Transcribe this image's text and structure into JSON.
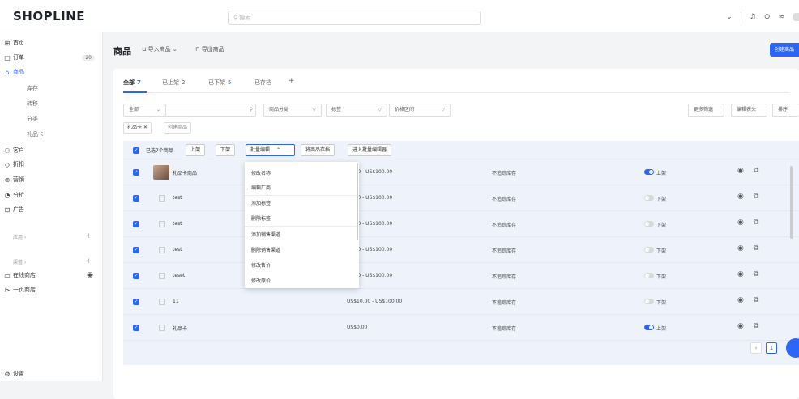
{
  "header": {
    "logo": "SHOPLINE",
    "search_placeholder": "搜索",
    "icons": [
      "chevron-down-icon",
      "bell-icon",
      "help-icon",
      "wifi-icon"
    ]
  },
  "sidebar": {
    "items": [
      {
        "icon": "⊞",
        "label": "首页"
      },
      {
        "icon": "▢",
        "label": "订单",
        "count": "20"
      },
      {
        "icon": "⌂",
        "label": "商品",
        "active": true
      },
      {
        "label": "库存"
      },
      {
        "label": "转移"
      },
      {
        "label": "分类"
      },
      {
        "label": "礼品卡"
      },
      {
        "icon": "⚇",
        "label": "客户"
      },
      {
        "icon": "◇",
        "label": "折扣"
      },
      {
        "icon": "⊚",
        "label": "营销"
      },
      {
        "icon": "◔",
        "label": "分析"
      },
      {
        "icon": "⊡",
        "label": "广告"
      }
    ],
    "apps_label": "应用 ›",
    "channels_label": "渠道 ›",
    "channel_items": [
      "在线商店",
      "一页商店"
    ],
    "settings_label": "设置"
  },
  "page": {
    "title": "商品",
    "import_label": "导入商品",
    "export_label": "导出商品",
    "create_label": "创建商品"
  },
  "tabs": [
    {
      "label": "全部",
      "count": "7"
    },
    {
      "label": "已上架",
      "count": "2"
    },
    {
      "label": "已下架",
      "count": "5"
    },
    {
      "label": "已存档",
      "count": ""
    },
    {
      "label": "+",
      "count": ""
    }
  ],
  "filters": {
    "scope": "全部",
    "category": "商品分类",
    "tags": "标签",
    "price_range": "价格区间",
    "more_filters": "更多筛选",
    "edit_header": "编辑表头",
    "sort": "排序"
  },
  "active_tags": [
    "礼品卡 ✕",
    "创建商品"
  ],
  "bulk": {
    "selected_text": "已选7个商品",
    "list_on": "上架",
    "list_off": "下架",
    "bulk_edit": "批量编辑",
    "archive": "将商品存档",
    "bulk_editor": "进入批量编辑器"
  },
  "dropdown_items": [
    "修改名称",
    "编辑厂商",
    "添加标签",
    "删除标签",
    "添加销售渠道",
    "删除销售渠道",
    "修改售价",
    "修改原价"
  ],
  "products": [
    {
      "name": "礼品卡商品",
      "price": "10.00 - US$100.00",
      "stock": "不追踪库存",
      "status": "上架",
      "on": true,
      "thumb": true
    },
    {
      "name": "test",
      "price": "10.00 - US$100.00",
      "stock": "不追踪库存",
      "status": "下架",
      "on": false
    },
    {
      "name": "test",
      "price": "10.00 - US$100.00",
      "stock": "不追踪库存",
      "status": "下架",
      "on": false
    },
    {
      "name": "test",
      "price": "10.00 - US$100.00",
      "stock": "不追踪库存",
      "status": "下架",
      "on": false
    },
    {
      "name": "teset",
      "price": "10.00 - US$100.00",
      "stock": "不追踪库存",
      "status": "下架",
      "on": false
    },
    {
      "name": "11",
      "price": "US$10.00 - US$100.00",
      "stock": "不追踪库存",
      "status": "下架",
      "on": false
    },
    {
      "name": "礼品卡",
      "price": "US$0.00",
      "stock": "不追踪库存",
      "status": "上架",
      "on": true
    }
  ],
  "pagination": {
    "current": "1"
  }
}
